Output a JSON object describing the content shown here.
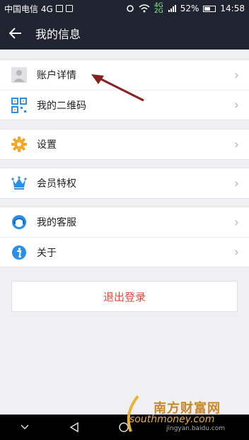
{
  "statusbar": {
    "carrier": "中国电信 4G",
    "battery": "52%",
    "time": "14:58",
    "mini_top": "4G",
    "mini_bottom": "2G"
  },
  "header": {
    "title": "我的信息",
    "back_icon": "arrow-left-icon"
  },
  "groups": [
    {
      "items": [
        {
          "label": "账户详情",
          "icon": "avatar-icon"
        },
        {
          "label": "我的二维码",
          "icon": "qrcode-icon"
        }
      ]
    },
    {
      "items": [
        {
          "label": "设置",
          "icon": "gear-icon"
        }
      ]
    },
    {
      "items": [
        {
          "label": "会员特权",
          "icon": "crown-icon"
        }
      ]
    },
    {
      "items": [
        {
          "label": "我的客服",
          "icon": "headset-icon"
        },
        {
          "label": "关于",
          "icon": "info-icon"
        }
      ]
    }
  ],
  "logout": {
    "label": "退出登录",
    "color": "#e5483d"
  },
  "watermark": {
    "title": "南方财富网",
    "subtitle": "southmoney.com",
    "small": "jingyan.baidu.com"
  },
  "colors": {
    "header_bg": "#1f2430",
    "page_bg": "#f0f0f2",
    "accent_orange": "#f5a623",
    "accent_blue": "#2a8fe8"
  }
}
